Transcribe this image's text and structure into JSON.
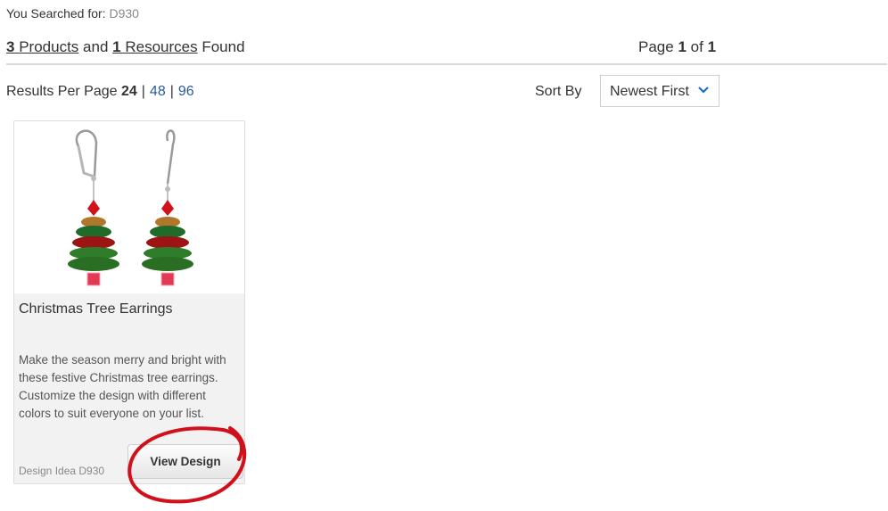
{
  "search": {
    "label": "You Searched for:",
    "term": "D930"
  },
  "results": {
    "products_count": "3",
    "products_label": "Products",
    "and_label": "and",
    "resources_count": "1",
    "resources_label": "Resources",
    "found_label": "Found",
    "page_label": "Page",
    "page_current": "1",
    "page_of": "of",
    "page_total": "1"
  },
  "per_page": {
    "label": "Results Per Page",
    "current": "24",
    "options": [
      "48",
      "96"
    ],
    "separator": "|"
  },
  "sort": {
    "label": "Sort By",
    "selected": "Newest First"
  },
  "product": {
    "title": "Christmas Tree Earrings",
    "description": "Make the season merry and bright with these festive Christmas tree earrings. Customize the design with different colors to suit everyone on your list.",
    "idea_label": "Design Idea D930",
    "button_label": "View Design"
  },
  "colors": {
    "link": "#2a5a9a",
    "annotation": "#d0101a",
    "accent": "#1a6fc0"
  }
}
